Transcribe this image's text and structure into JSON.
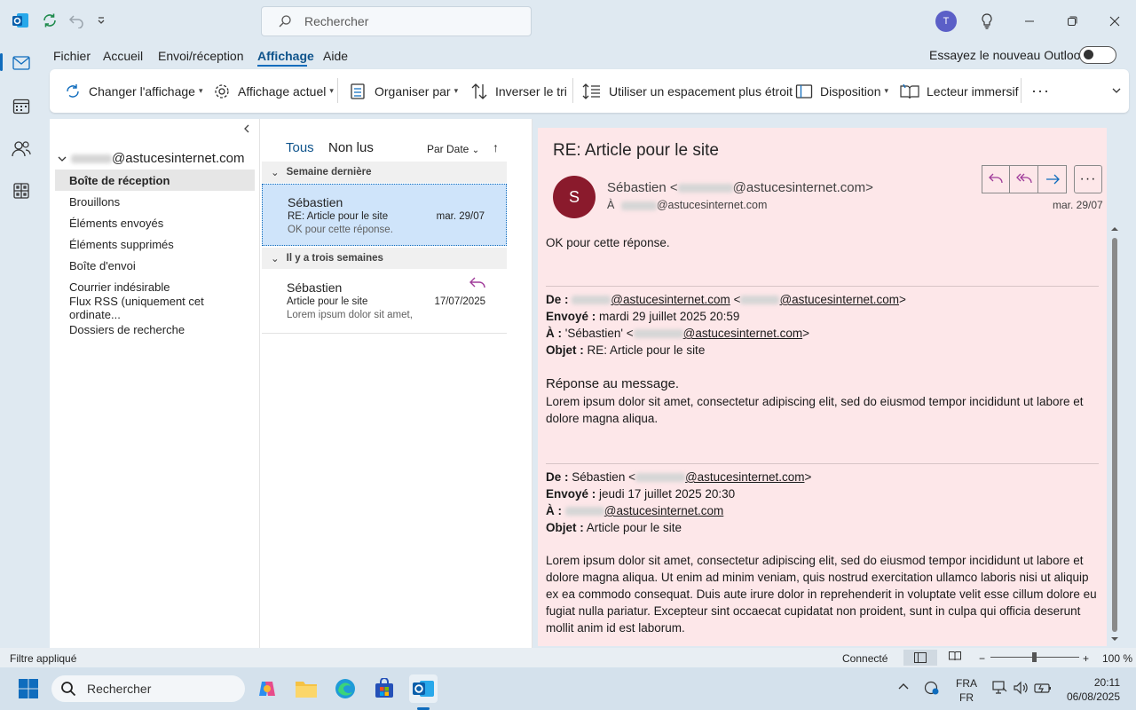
{
  "titlebar": {
    "search_placeholder": "Rechercher",
    "avatar_initial": "T"
  },
  "menu": {
    "items": [
      "Fichier",
      "Accueil",
      "Envoi/réception",
      "Affichage",
      "Aide"
    ],
    "active": "Affichage",
    "try_new": "Essayez le nouveau Outlook"
  },
  "ribbon": {
    "change_view": "Changer l'affichage",
    "current_view": "Affichage actuel",
    "arrange_by": "Organiser par",
    "reverse_sort": "Inverser le tri",
    "compact_spacing": "Utiliser un espacement plus étroit",
    "layout": "Disposition",
    "immersive_reader": "Lecteur immersif",
    "more": "···"
  },
  "folders": {
    "account_suffix": "@astucesinternet.com",
    "items": [
      "Boîte de réception",
      "Brouillons",
      "Éléments envoyés",
      "Éléments supprimés",
      "Boîte d'envoi",
      "Courrier indésirable",
      "Flux RSS (uniquement cet ordinate...",
      "Dossiers de recherche"
    ]
  },
  "list": {
    "tab_all": "Tous",
    "tab_unread": "Non lus",
    "sort_by": "Par Date",
    "group1": "Semaine dernière",
    "group2": "Il y a trois semaines",
    "mail1": {
      "sender": "Sébastien",
      "subject": "RE: Article pour le site",
      "date": "mar. 29/07",
      "preview": "OK pour cette réponse."
    },
    "mail2": {
      "sender": "Sébastien",
      "subject": "Article pour le site",
      "date": "17/07/2025",
      "preview": "Lorem ipsum dolor sit amet,"
    }
  },
  "reading": {
    "subject": "RE: Article pour le site",
    "avatar_initial": "S",
    "from_name": "Sébastien <",
    "domain": "@astucesinternet.com",
    "from_close": ">",
    "to_label": "À",
    "date": "mar. 29/07",
    "first_line": "OK pour cette réponse.",
    "q1": {
      "de_label": "De :",
      "lt": "<",
      "gt": ">",
      "envoye_label": "Envoyé :",
      "envoye": "mardi 29 juillet 2025 20:59",
      "a_label": "À :",
      "a_name": "'Sébastien' <",
      "objet_label": "Objet :",
      "objet": "RE: Article pour le site",
      "body_title": "Réponse au message.",
      "body": "Lorem ipsum dolor sit amet, consectetur adipiscing elit, sed do eiusmod tempor incididunt ut labore et dolore magna aliqua."
    },
    "q2": {
      "de_label": "De :",
      "de_name": "Sébastien <",
      "envoye_label": "Envoyé :",
      "envoye": "jeudi 17 juillet 2025 20:30",
      "a_label": "À :",
      "objet_label": "Objet :",
      "objet": "Article pour le site",
      "body": "Lorem ipsum dolor sit amet, consectetur adipiscing elit, sed do eiusmod tempor incididunt ut labore et dolore magna aliqua. Ut enim ad minim veniam, quis nostrud exercitation ullamco laboris nisi ut aliquip ex ea commodo consequat. Duis aute irure dolor in reprehenderit in voluptate velit esse cillum dolore eu fugiat nulla pariatur. Excepteur sint occaecat cupidatat non proident, sunt in culpa qui officia deserunt mollit anim id est laborum."
    }
  },
  "status": {
    "filter": "Filtre appliqué",
    "connected": "Connecté",
    "zoom": "100 %",
    "zoom_minus": "−",
    "zoom_plus": "+"
  },
  "taskbar": {
    "search": "Rechercher",
    "lang1": "FRA",
    "lang2": "FR",
    "time": "20:11",
    "date": "06/08/2025"
  },
  "colors": {
    "accent": "#0f6cbd",
    "reading_bg": "#fde7e9",
    "selected_item": "#cfe4fa",
    "avatar_sender": "#8a1a2c"
  }
}
